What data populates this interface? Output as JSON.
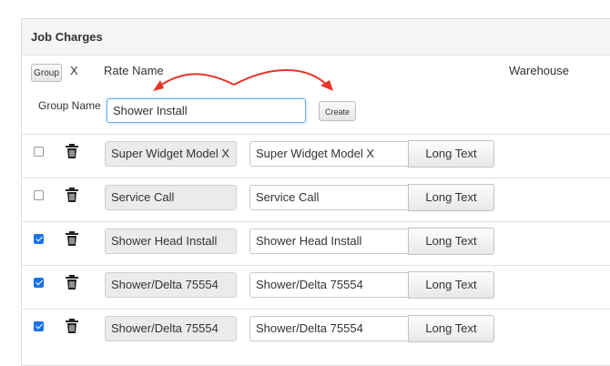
{
  "panel": {
    "title": "Job Charges",
    "group_button_label": "Group",
    "close_x_label": "X",
    "rate_name_label": "Rate Name",
    "warehouse_label": "Warehouse",
    "group_name_label": "Group Name",
    "group_name_value": "Shower Install",
    "create_button_label": "Create"
  },
  "rows": [
    {
      "checked": false,
      "rate_name": "Super  Widget Model X",
      "display_name": "Super  Widget Model X",
      "button_label": "Long Text"
    },
    {
      "checked": false,
      "rate_name": "Service Call",
      "display_name": "Service Call",
      "button_label": "Long Text"
    },
    {
      "checked": true,
      "rate_name": "Shower Head Install",
      "display_name": "Shower Head Install",
      "button_label": "Long Text"
    },
    {
      "checked": true,
      "rate_name": "Shower/Delta   75554",
      "display_name": "Shower/Delta   75554",
      "button_label": "Long Text"
    },
    {
      "checked": true,
      "rate_name": "Shower/Delta   75554",
      "display_name": "Shower/Delta   75554",
      "button_label": "Long Text"
    }
  ],
  "colors": {
    "annotation_arrow": "#e53527",
    "checkbox_checked": "#1a73e8"
  },
  "icons": {
    "row_delete": "trash-icon"
  }
}
